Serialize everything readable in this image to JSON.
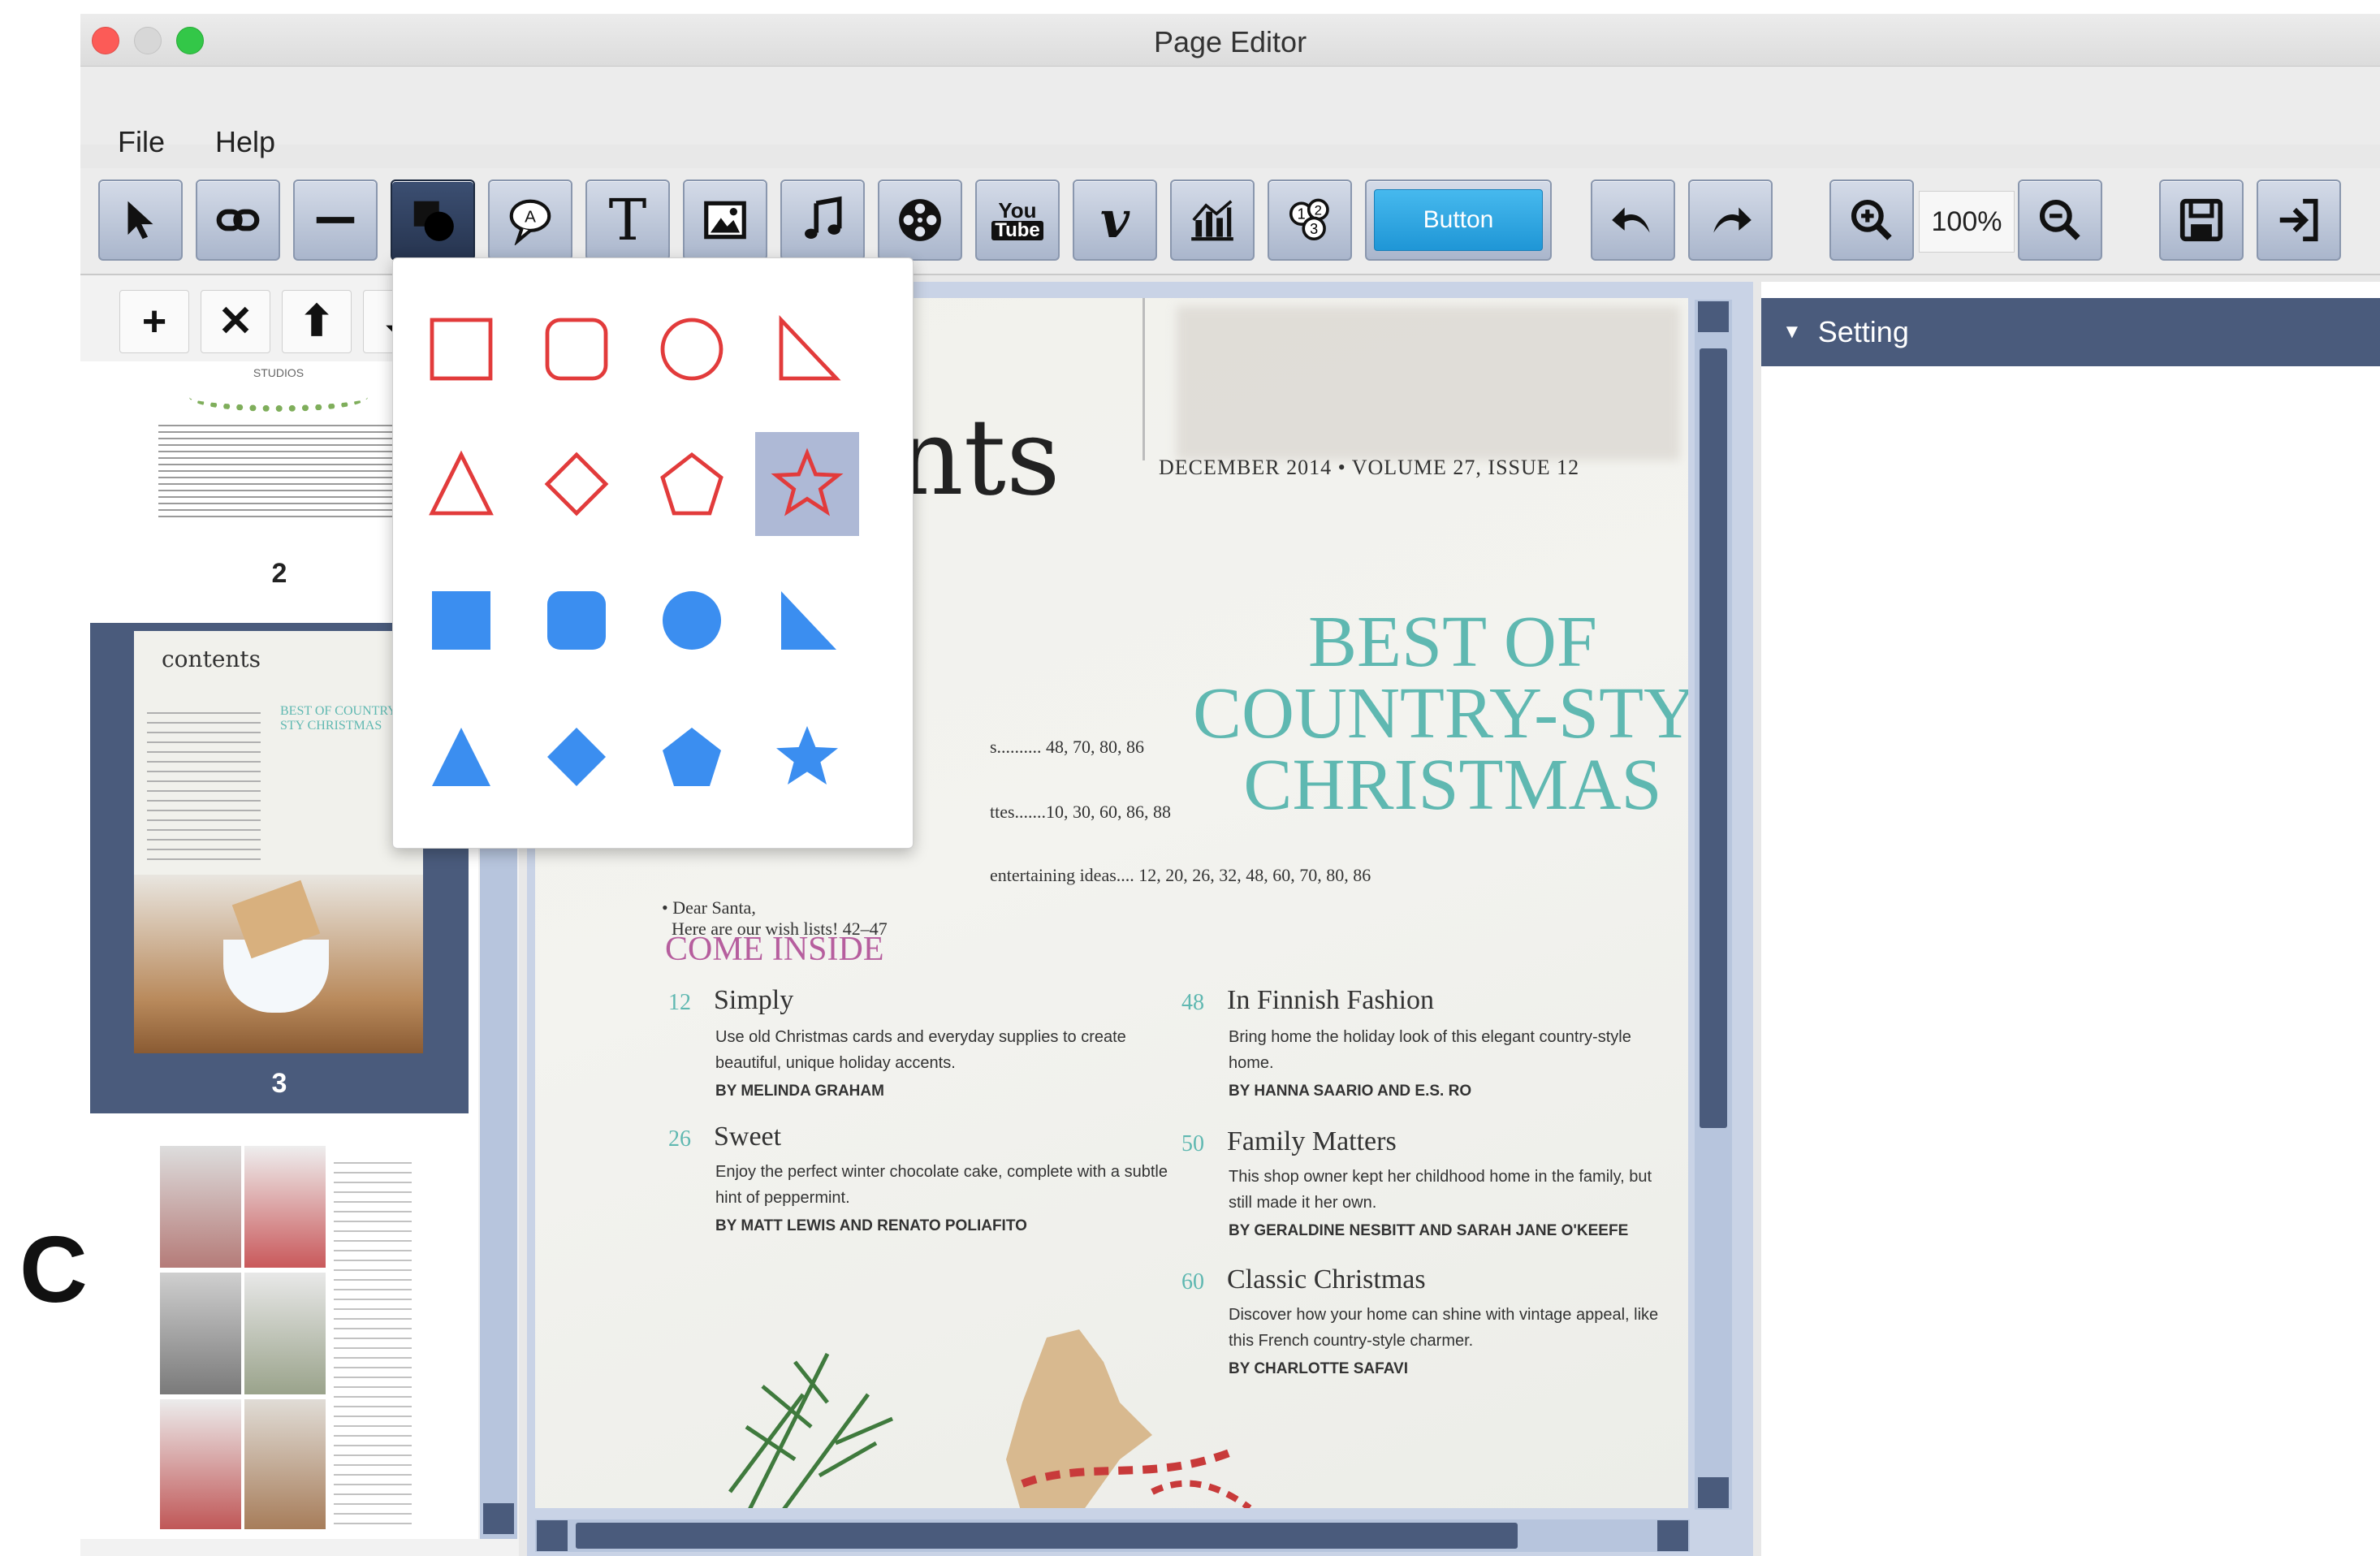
{
  "window": {
    "title": "Page Editor"
  },
  "menu": {
    "items": [
      "File",
      "Help"
    ]
  },
  "toolbar": {
    "youtube_top": "You",
    "youtube_bottom": "Tube",
    "vimeo": "v",
    "text_tool": "T",
    "button_label": "Button",
    "zoom": "100%"
  },
  "left_tools": {
    "add": "+",
    "remove": "✕",
    "up": "⬆"
  },
  "thumbnails": [
    {
      "page": "2",
      "caption": "STUDIOS"
    },
    {
      "page": "3",
      "caption": "contents"
    },
    {
      "page": ""
    }
  ],
  "document": {
    "heading_fragment": "nts",
    "issue": "DECEMBER 2014 • VOLUME 27, ISSUE 12",
    "feature_lines": [
      "BEST OF",
      "COUNTRY-STYL",
      "CHRISTMAS"
    ],
    "page_lists": [
      "s.......... 48, 70, 80, 86",
      "ttes.......10, 30, 60, 86, 88",
      "entertaining ideas.... 12, 20, 26, 32, 48, 60, 70, 80, 86"
    ],
    "dear_santa": "• Dear Santa,",
    "dear_santa_line2": "Here are our wish lists!     42–47",
    "section_title": "COME INSIDE",
    "entries": [
      {
        "num": "12",
        "title": "Simply",
        "desc": "Use old Christmas cards and everyday supplies to create beautiful, unique holiday accents.",
        "by": "BY MELINDA GRAHAM"
      },
      {
        "num": "26",
        "title": "Sweet",
        "desc": "Enjoy the perfect winter chocolate cake, complete with a subtle hint of peppermint.",
        "by": "BY MATT LEWIS AND RENATO POLIAFITO"
      },
      {
        "num": "48",
        "title": "In Finnish Fashion",
        "desc": "Bring home the holiday look of this elegant country-style home.",
        "by": "BY HANNA SAARIO AND E.S. RO"
      },
      {
        "num": "50",
        "title": "Family Matters",
        "desc": "This shop owner kept her childhood home in the family, but still made it her own.",
        "by": "BY GERALDINE NESBITT AND SARAH JANE O'KEEFE"
      },
      {
        "num": "60",
        "title": "Classic Christmas",
        "desc": "Discover how your home can shine with vintage appeal, like this French country-style charmer.",
        "by": "BY CHARLOTTE SAFAVI"
      }
    ]
  },
  "right_panel": {
    "title": "Setting"
  },
  "edge_letter": "C",
  "colors": {
    "accent": "#4a5b7c",
    "shape_outline": "#e23b3b",
    "shape_fill": "#3b8ef0",
    "feature_teal": "#5fb8b1",
    "section_pink": "#b65e9e",
    "button_blue": "#1f96d6"
  }
}
